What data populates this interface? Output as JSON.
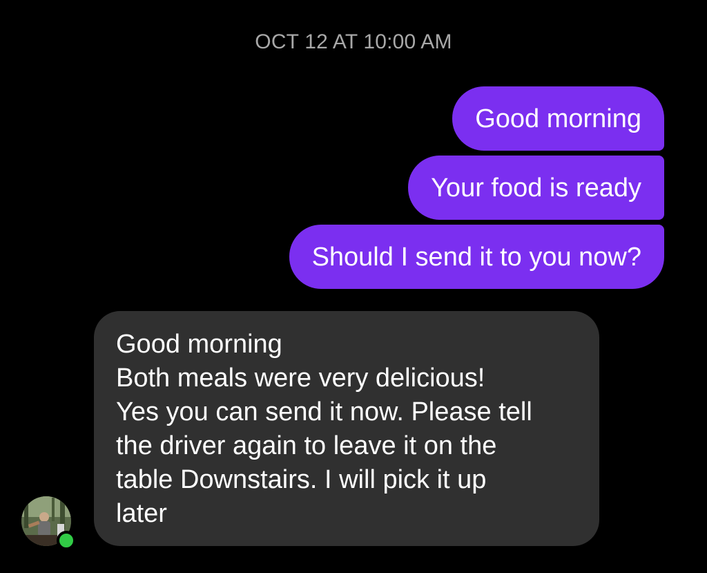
{
  "conversation": {
    "timestamp": "OCT 12 AT 10:00 AM",
    "sent_messages": [
      "Good morning",
      "Your food is ready",
      "Should I send it to you now?"
    ],
    "received_message": {
      "lines": [
        "Good morning",
        "Both meals were very delicious!",
        "Yes you can send it now. Please tell",
        "the driver again to leave it on the",
        "table Downstairs. I will pick it up",
        "later"
      ]
    },
    "contact": {
      "avatar_icon": "profile-photo",
      "online": true
    }
  },
  "colors": {
    "background": "#000000",
    "sent_bubble": "#7b2ff0",
    "received_bubble": "#303030",
    "timestamp_text": "#a8a8a8",
    "online_indicator": "#31cc46"
  }
}
